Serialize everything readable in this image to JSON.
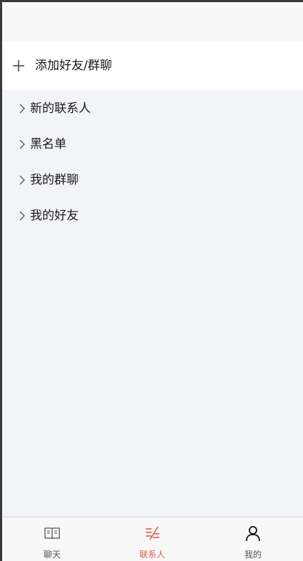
{
  "header": {
    "add_label": "添加好友/群聊"
  },
  "contacts": {
    "items": [
      {
        "label": "新的联系人"
      },
      {
        "label": "黑名单"
      },
      {
        "label": "我的群聊"
      },
      {
        "label": "我的好友"
      }
    ]
  },
  "tabbar": {
    "tabs": [
      {
        "label": "聊天",
        "icon": "book-icon",
        "active": false
      },
      {
        "label": "联系人",
        "icon": "contacts-icon",
        "active": true
      },
      {
        "label": "我的",
        "icon": "user-icon",
        "active": false
      }
    ]
  },
  "colors": {
    "accent": "#e05a47",
    "inactive": "#555555",
    "background": "#f3f3fc"
  }
}
